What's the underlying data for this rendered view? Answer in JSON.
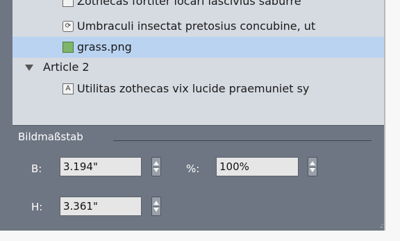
{
  "tree": {
    "rows": [
      {
        "label": "Zothecas fortiter locari lascivius saburre",
        "icon": "text-frame-icon"
      },
      {
        "label": "Umbraculi insectat pretosius concubine, ut",
        "icon": "linked-content-icon"
      },
      {
        "label": "grass.png",
        "icon": "image-icon",
        "selected": true
      },
      {
        "label": "Article 2",
        "icon": "disclosure-triangle-icon"
      },
      {
        "label": "Utilitas zothecas vix lucide praemuniet sy",
        "icon": "text-frame-icon"
      }
    ]
  },
  "panel": {
    "title": "Bildmaßstab",
    "width_label": "B:",
    "width_value": "3.194\"",
    "percent_label": "%:",
    "percent_value": "100%",
    "height_label": "H:",
    "height_value": "3.361\""
  },
  "colors": {
    "panel_bg": "#6e7683",
    "tree_bg": "#d6dae1",
    "selection": "#b9d3f1"
  }
}
